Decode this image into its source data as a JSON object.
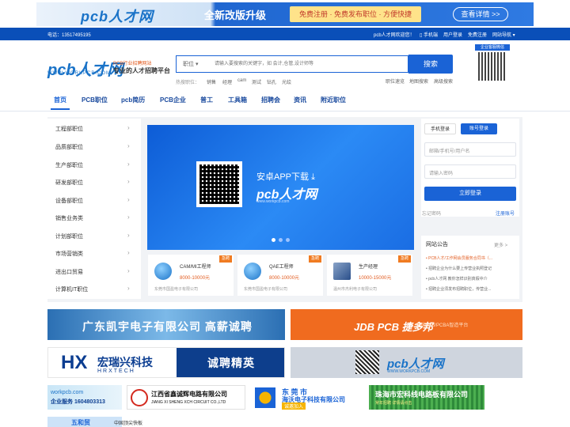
{
  "top_banner": {
    "logo": "pcb人才网",
    "slogan": "全新改版升级",
    "tagline": "免费注册 · 免费发布职位 · 方便快捷",
    "button": "查看详情 >>"
  },
  "top_bar": {
    "phone": "电话：13517495195",
    "welcome": "pcb人才网欢迎您！",
    "links": [
      "手机端",
      "用户登录",
      "免费注册",
      "网站导航"
    ]
  },
  "header": {
    "logo": "pcb人才网",
    "logo_url": "WWW.WORKPCB.COM",
    "logo_tag1": "PCB行业招聘网站",
    "logo_tag2": "专业的人才招聘平台",
    "search_category": "职位",
    "search_placeholder": "请输入要搜索的关键字，如 会计,仓管,设计师等",
    "search_button": "搜索",
    "hot_label": "热搜职位：",
    "hot_words": [
      "销售",
      "经理",
      "cam",
      "测试",
      "钻孔",
      "光绘"
    ],
    "adv_links": [
      "职位速览",
      "地图搜索",
      "高级搜索"
    ],
    "qr_title": "企业客服微信"
  },
  "nav": [
    "首页",
    "PCB职位",
    "pcb简历",
    "PCB企业",
    "普工",
    "工具箱",
    "招聘会",
    "资讯",
    "附近职位"
  ],
  "sidebar": [
    "工程部职位",
    "品质部职位",
    "生产部职位",
    "研发部职位",
    "设备部职位",
    "销售业务类",
    "计划部职位",
    "市场营销类",
    "进出口贸易",
    "计算机IT职位"
  ],
  "carousel": {
    "text": "安卓APP下载",
    "logo": "pcb人才网",
    "url": "www.workpcb.com"
  },
  "jobs": [
    {
      "title": "CAM/MI工程师",
      "salary": "8000-10000元",
      "company": "东莞市国盈电子有限公司",
      "badge": "急聘"
    },
    {
      "title": "QAE工程师",
      "salary": "8000-10000元",
      "company": "东莞市国盈电子有限公司",
      "badge": "急聘"
    },
    {
      "title": "生产经理",
      "salary": "10000-15000元",
      "company": "温州市杰利电子有限公司",
      "badge": "急聘"
    }
  ],
  "login": {
    "tab_phone": "手机登录",
    "tab_account": "账号登录",
    "username_placeholder": "邮箱/手机号/用户名",
    "password_placeholder": "请输入密码",
    "button": "立即登录",
    "forgot": "忘记密码",
    "register": "注册账号"
  },
  "notice": {
    "title": "网站公告",
    "more": "更多 >",
    "items": [
      "PCB人才/工作网会员服务合同书（...",
      "招聘企业为什么要上传营业执照登记",
      "pcb人才网 教你怎样识别真假中介",
      "招聘企业须发布招聘职位，传营业..."
    ]
  },
  "ads": {
    "ad1": "广东凯宇电子有限公司 高薪诚聘",
    "ad2_t1": "JDB PCB 捷多邦",
    "ad2_t2": "全球PCB/PCBA智造平台",
    "ad3_logo": "HX",
    "ad3_t1": "宏瑞兴科技",
    "ad3_t2": "HRXTECH",
    "ad3_r": "诚聘精英",
    "ad4_t1": "pcb人才网",
    "ad4_t2": "WWW.WORKPCB.COM",
    "ad5_t1": "workpcb.com",
    "ad5_t2": "企业服务 1604803313",
    "ad6_t1": "江西省鑫诚辉电路有限公司",
    "ad6_t2": "JIANG XI SHENG XCH CIRCUIT CO.,LTD",
    "ad7_t1": "东 莞 市",
    "ad7_t2": "海沃电子科技有限公司",
    "ad7_t3": "诚邀加入",
    "ad8_t1": "珠海市宏科线电路板有限公司",
    "ad8_t2": "常年招聘 详情请点击",
    "ad9": "五和贸",
    "ad10": "中国顶尖快板"
  }
}
